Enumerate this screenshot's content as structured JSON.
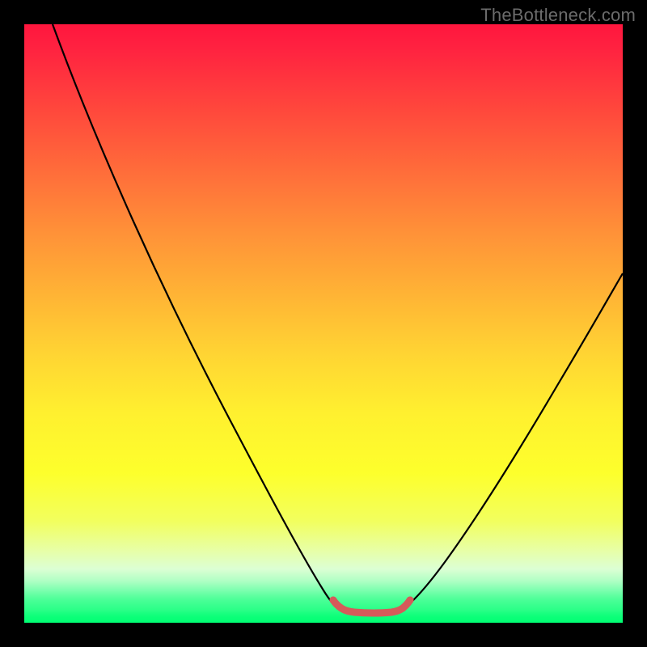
{
  "watermark": "TheBottleneck.com",
  "colors": {
    "frame": "#000000",
    "curve": "#000000",
    "highlight": "#d55a5a"
  },
  "chart_data": {
    "type": "line",
    "title": "",
    "xlabel": "",
    "ylabel": "",
    "xlim": [
      0,
      100
    ],
    "ylim": [
      0,
      100
    ],
    "series": [
      {
        "name": "left-curve",
        "x": [
          0,
          5,
          10,
          15,
          20,
          25,
          30,
          35,
          40,
          45,
          48,
          51
        ],
        "values": [
          100,
          92,
          83,
          74,
          64,
          54,
          44,
          34,
          23,
          12,
          6,
          3
        ]
      },
      {
        "name": "right-curve",
        "x": [
          62,
          65,
          68,
          72,
          76,
          80,
          84,
          88,
          92,
          96,
          100
        ],
        "values": [
          3,
          6,
          10,
          16,
          22,
          28,
          34,
          40,
          46,
          52,
          58
        ]
      },
      {
        "name": "bottom-highlight",
        "x": [
          50,
          52,
          54,
          56,
          58,
          60,
          62
        ],
        "values": [
          3,
          2,
          2,
          2,
          2,
          2,
          3
        ]
      }
    ],
    "grid": false
  }
}
